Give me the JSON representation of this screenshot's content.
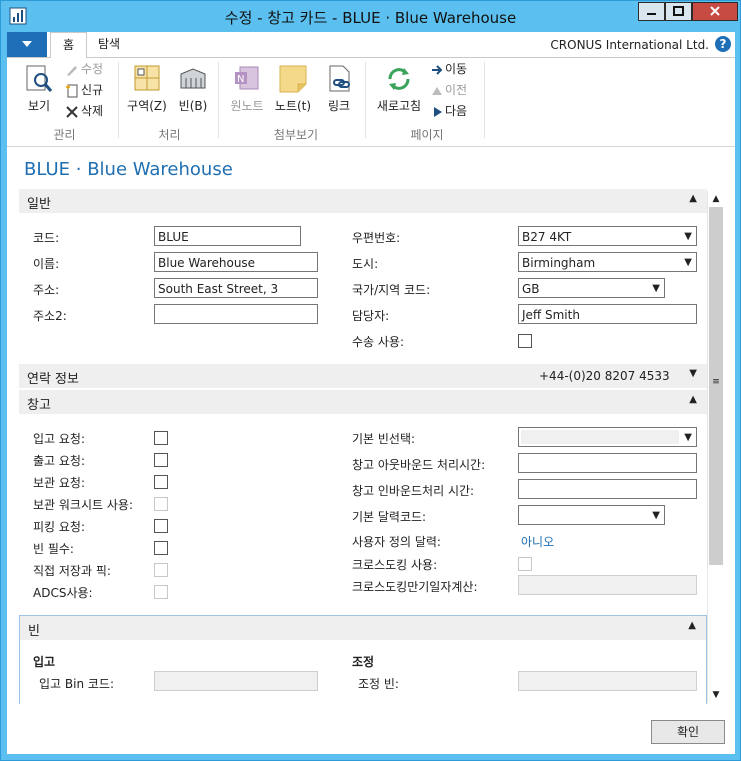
{
  "window": {
    "title": "수정 - 창고 카드 - BLUE · Blue Warehouse"
  },
  "ribbon_tabs": {
    "home": "홈",
    "navigate": "탐색"
  },
  "company": "CRONUS International Ltd.",
  "ribbon": {
    "manage": {
      "label": "관리",
      "view": "보기",
      "edit": "수정",
      "new": "신규",
      "delete": "삭제"
    },
    "process": {
      "label": "처리",
      "zones": "구역(Z)",
      "bins": "빈(B)"
    },
    "attach": {
      "label": "첨부보기",
      "onenote": "원노트",
      "notes": "노트(t)",
      "links": "링크"
    },
    "page": {
      "label": "페이지",
      "refresh": "새로고침",
      "goto": "이동",
      "previous": "이전",
      "next": "다음"
    }
  },
  "page_title": "BLUE · Blue Warehouse",
  "general": {
    "header": "일반",
    "code_label": "코드:",
    "code_value": "BLUE",
    "name_label": "이름:",
    "name_value": "Blue Warehouse",
    "address_label": "주소:",
    "address_value": "South East Street, 3",
    "address2_label": "주소2:",
    "address2_value": "",
    "postcode_label": "우편번호:",
    "postcode_value": "B27 4KT",
    "city_label": "도시:",
    "city_value": "Birmingham",
    "country_label": "국가/지역 코드:",
    "country_value": "GB",
    "contact_label": "담당자:",
    "contact_value": "Jeff Smith",
    "shipping_label": "수송 사용:"
  },
  "contact": {
    "header": "연락 정보",
    "phone": "+44-(0)20 8207 4533"
  },
  "warehouse": {
    "header": "창고",
    "require_receive": "입고 요청:",
    "require_shipment": "출고 요청:",
    "require_putaway": "보관 요청:",
    "use_putaway_worksheet": "보관 워크시트 사용:",
    "require_pick": "피킹 요청:",
    "bin_mandatory": "빈 필수:",
    "directed_putaway": "직접 저장과 픽:",
    "adcs": "ADCS사용:",
    "default_bin_selection": "기본 빈선택:",
    "outbound_handling_time": "창고 아웃바운드 처리시간:",
    "inbound_handling_time": "창고 인바운드처리 시간:",
    "base_calendar": "기본 달력코드:",
    "customized_calendar": "사용자 정의 달력:",
    "customized_calendar_value": "아니오",
    "use_cross_docking": "크로스도킹 사용:",
    "cross_dock_due_date": "크로스도킹만기일자계산:"
  },
  "bins": {
    "header": "빈",
    "receipt_heading": "입고",
    "receipt_bin_code": "입고 Bin 코드:",
    "adjustment_heading": "조정",
    "adjustment_bin": "조정 빈:"
  },
  "ok_button": "확인"
}
